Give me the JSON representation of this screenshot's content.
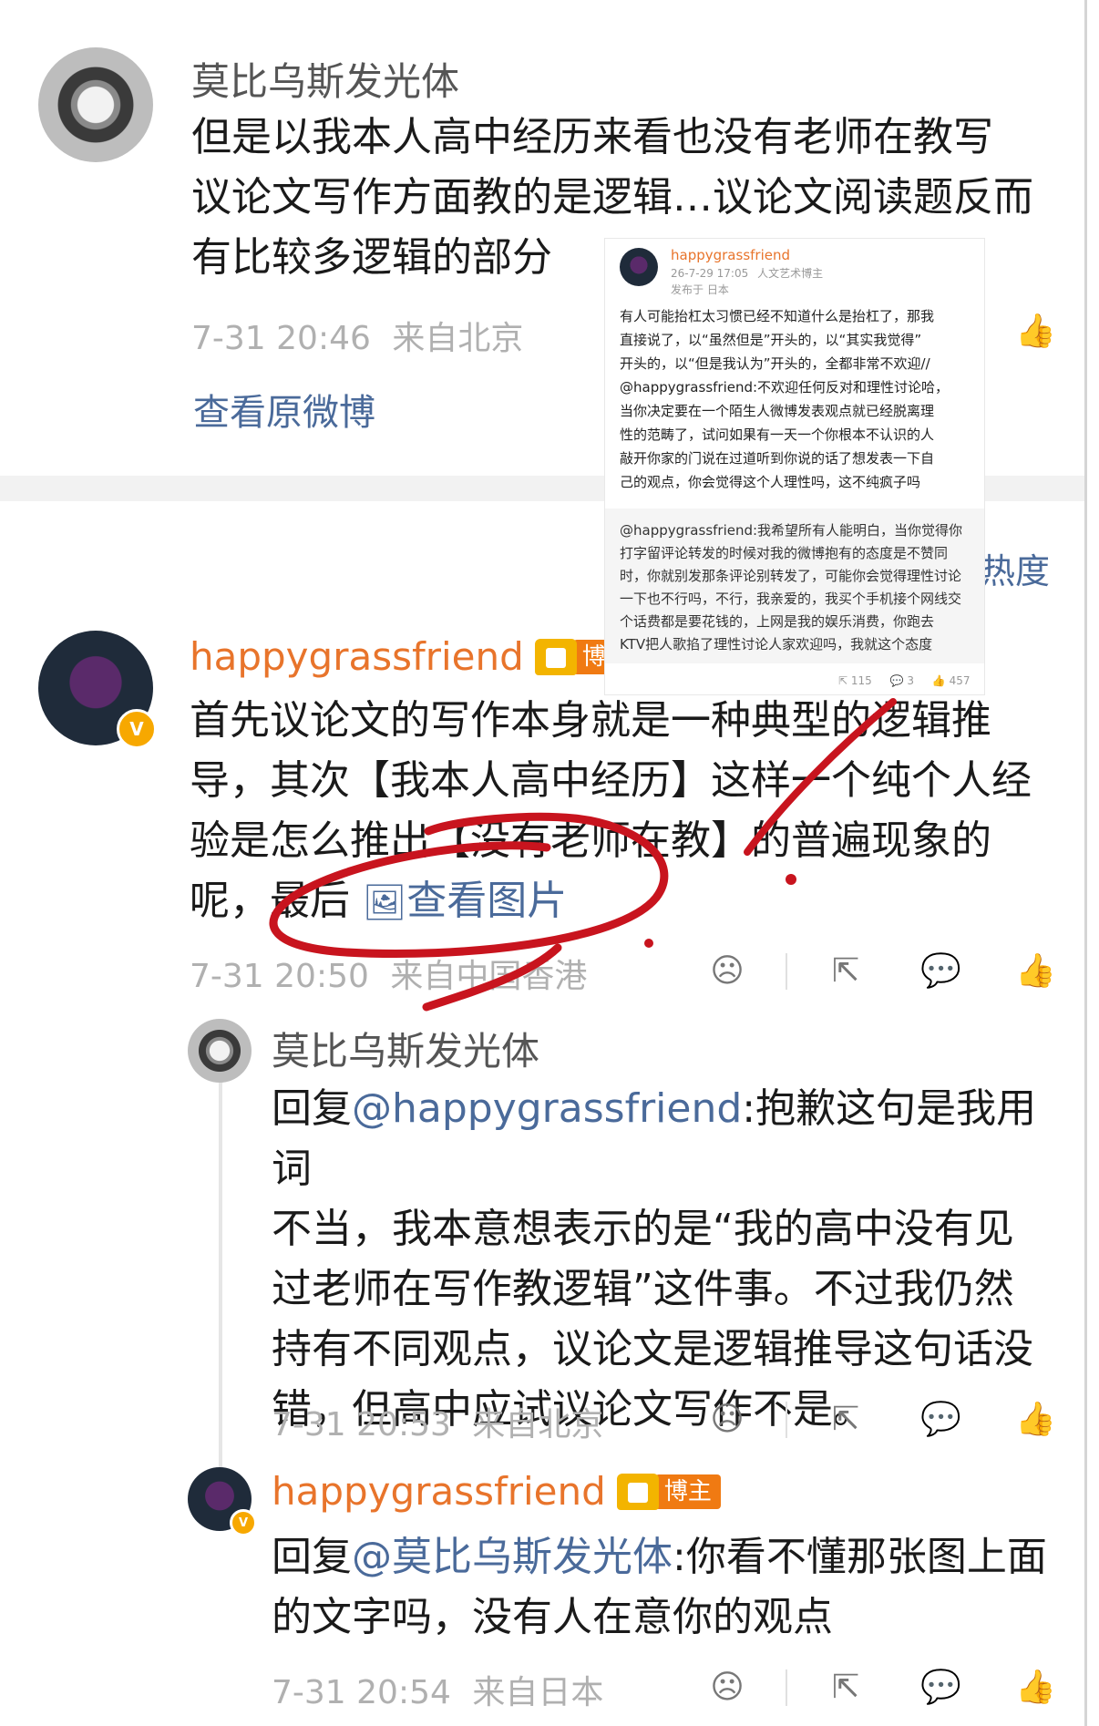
{
  "comment1": {
    "author": "莫比乌斯发光体",
    "text_lines": [
      "但是以我本人高中经历来看也没有老师在教写",
      "议论文写作方面教的是逻辑…议论文阅读题反而",
      "有比较多逻辑的部分"
    ],
    "time": "7-31 20:46",
    "location": "来自北京",
    "view_original": "查看原微博"
  },
  "sort_tab": "热度",
  "comment2": {
    "author": "happygrassfriend",
    "badge": "博主",
    "verify_mark": "V",
    "text_lines": [
      "首先议论文的写作本身就是一种典型的逻辑推",
      "导，其次【我本人高中经历】这样一个纯个人经",
      "验是怎么推出【没有老师在教】的普遍现象的"
    ],
    "last_line_prefix": "呢，最后",
    "view_image": "查看图片",
    "time": "7-31 20:50",
    "location": "来自中国香港"
  },
  "reply1": {
    "author": "莫比乌斯发光体",
    "prefix": "回复",
    "mention": "@happygrassfriend",
    "text_first": ":抱歉这句是我用词",
    "text_lines": [
      "不当，我本意想表示的是“我的高中没有见",
      "过老师在写作教逻辑”这件事。不过我仍然",
      "持有不同观点，议论文是逻辑推导这句话没",
      "错，但高中应试议论文写作不是。"
    ],
    "time": "7-31 20:53",
    "location": "来自北京"
  },
  "reply2": {
    "author": "happygrassfriend",
    "badge": "博主",
    "verify_mark": "V",
    "prefix": "回复",
    "mention": "@莫比乌斯发光体",
    "text_first": ":你看不懂那张图上面",
    "text_lines": [
      "的文字吗，没有人在意你的观点"
    ],
    "time": "7-31 20:54",
    "location": "来自日本"
  },
  "overlay_post": {
    "author": "happygrassfriend",
    "date": "26-7-29 17:05",
    "tag": "人文艺术博主",
    "published": "发布于 日本",
    "body_lines": [
      "有人可能抬杠太习惯已经不知道什么是抬杠了，那我",
      "直接说了，以“虽然但是”开头的，以“其实我觉得”",
      "开头的，以“但是我认为”开头的，全都非常不欢迎//",
      "@happygrassfriend:不欢迎任何反对和理性讨论哈，",
      "当你决定要在一个陌生人微博发表观点就已经脱离理",
      "性的范畴了，试问如果有一天一个你根本不认识的人",
      "敲开你家的门说在过道听到你说的话了想发表一下自",
      "己的观点，你会觉得这个人理性吗，这不纯疯子吗"
    ],
    "quote_lines": [
      "@happygrassfriend:我希望所有人能明白，当你觉得你",
      "打字留评论转发的时候对我的微博抱有的态度是不赞同",
      "时，你就别发那条评论别转发了，可能你会觉得理性讨论",
      "一下也不行吗，不行，我亲爱的，我买个手机接个网线交",
      "个话费都是要花钱的，上网是我的娱乐消费，你跑去",
      "KTV把人歌掐了理性讨论人家欢迎吗，我就这个态度"
    ],
    "reposts": "115",
    "comments": "3",
    "likes": "457"
  },
  "icons": [
    "thumbs-up-icon",
    "frown-icon",
    "share-icon",
    "comment-icon",
    "image-icon"
  ],
  "colors": {
    "accent_orange": "#e8742b",
    "link_blue": "#4a6a9a",
    "annotation_red": "#c8141e"
  }
}
